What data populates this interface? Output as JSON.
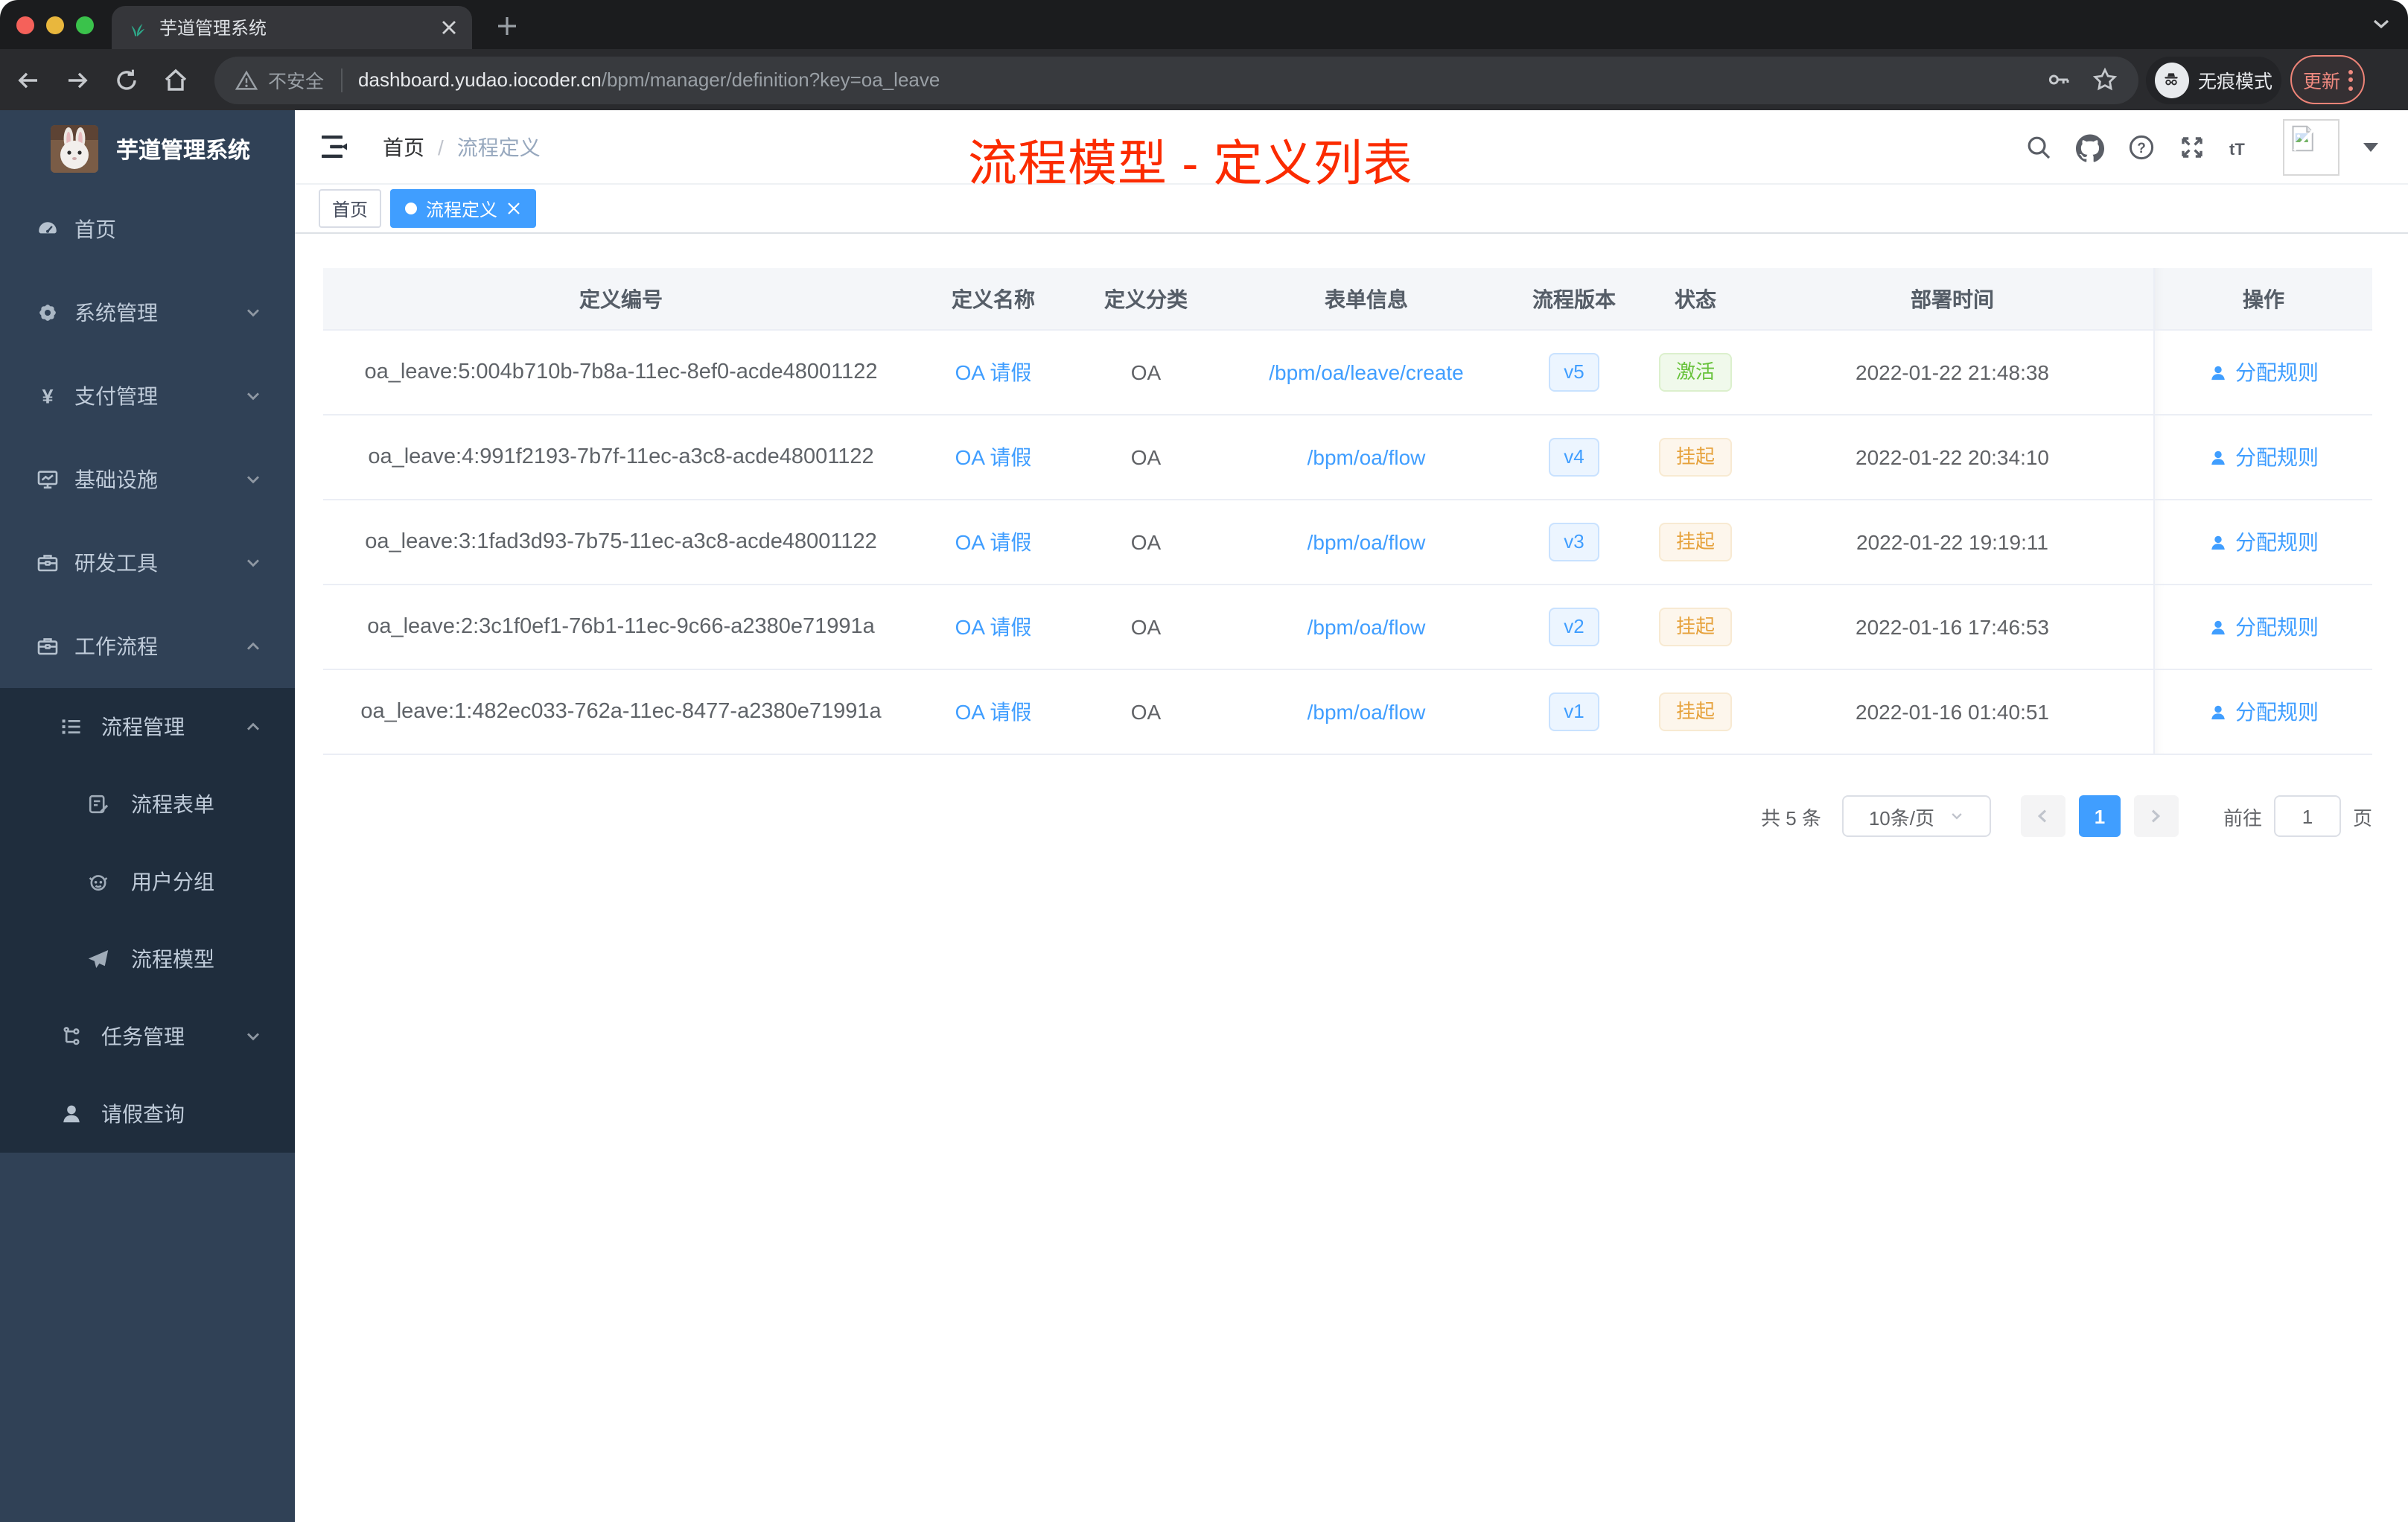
{
  "browser": {
    "tab_title": "芋道管理系统",
    "security_label": "不安全",
    "url_domain": "dashboard.yudao.iocoder.cn",
    "url_path": "/bpm/manager/definition?key=oa_leave",
    "incognito_label": "无痕模式",
    "update_label": "更新"
  },
  "icons": {
    "yen_glyph": "¥",
    "help_glyph": "?",
    "fontsize_glyph": "tT"
  },
  "sidebar": {
    "logo_title": "芋道管理系统",
    "items": [
      {
        "label": "首页"
      },
      {
        "label": "系统管理"
      },
      {
        "label": "支付管理"
      },
      {
        "label": "基础设施"
      },
      {
        "label": "研发工具"
      },
      {
        "label": "工作流程"
      },
      {
        "label": "流程管理"
      },
      {
        "label": "流程表单"
      },
      {
        "label": "用户分组"
      },
      {
        "label": "流程模型"
      },
      {
        "label": "任务管理"
      },
      {
        "label": "请假查询"
      }
    ]
  },
  "navbar": {
    "breadcrumb_home": "首页",
    "breadcrumb_sep": "/",
    "breadcrumb_current": "流程定义"
  },
  "annotation": "流程模型 - 定义列表",
  "tags": {
    "home": "首页",
    "active": "流程定义"
  },
  "table": {
    "columns": [
      "定义编号",
      "定义名称",
      "定义分类",
      "表单信息",
      "流程版本",
      "状态",
      "部署时间",
      "操作"
    ],
    "action_label": "分配规则",
    "rows": [
      {
        "id": "oa_leave:5:004b710b-7b8a-11ec-8ef0-acde48001122",
        "name": "OA 请假",
        "category": "OA",
        "form": "/bpm/oa/leave/create",
        "version": "v5",
        "status": "激活",
        "status_type": "active",
        "time": "2022-01-22 21:48:38"
      },
      {
        "id": "oa_leave:4:991f2193-7b7f-11ec-a3c8-acde48001122",
        "name": "OA 请假",
        "category": "OA",
        "form": "/bpm/oa/flow",
        "version": "v4",
        "status": "挂起",
        "status_type": "suspended",
        "time": "2022-01-22 20:34:10"
      },
      {
        "id": "oa_leave:3:1fad3d93-7b75-11ec-a3c8-acde48001122",
        "name": "OA 请假",
        "category": "OA",
        "form": "/bpm/oa/flow",
        "version": "v3",
        "status": "挂起",
        "status_type": "suspended",
        "time": "2022-01-22 19:19:11"
      },
      {
        "id": "oa_leave:2:3c1f0ef1-76b1-11ec-9c66-a2380e71991a",
        "name": "OA 请假",
        "category": "OA",
        "form": "/bpm/oa/flow",
        "version": "v2",
        "status": "挂起",
        "status_type": "suspended",
        "time": "2022-01-16 17:46:53"
      },
      {
        "id": "oa_leave:1:482ec033-762a-11ec-8477-a2380e71991a",
        "name": "OA 请假",
        "category": "OA",
        "form": "/bpm/oa/flow",
        "version": "v1",
        "status": "挂起",
        "status_type": "suspended",
        "time": "2022-01-16 01:40:51"
      }
    ]
  },
  "pagination": {
    "total": "共 5 条",
    "page_size": "10条/页",
    "current_page": "1",
    "goto_label": "前往",
    "goto_value": "1",
    "page_unit": "页"
  },
  "colors": {
    "accent_blue": "#409eff",
    "success_green": "#67c23a",
    "warning_orange": "#e6a23c",
    "annotation_red": "#fb2b00",
    "sidebar_bg": "#304156",
    "submenu_bg": "#1f2d3d"
  }
}
